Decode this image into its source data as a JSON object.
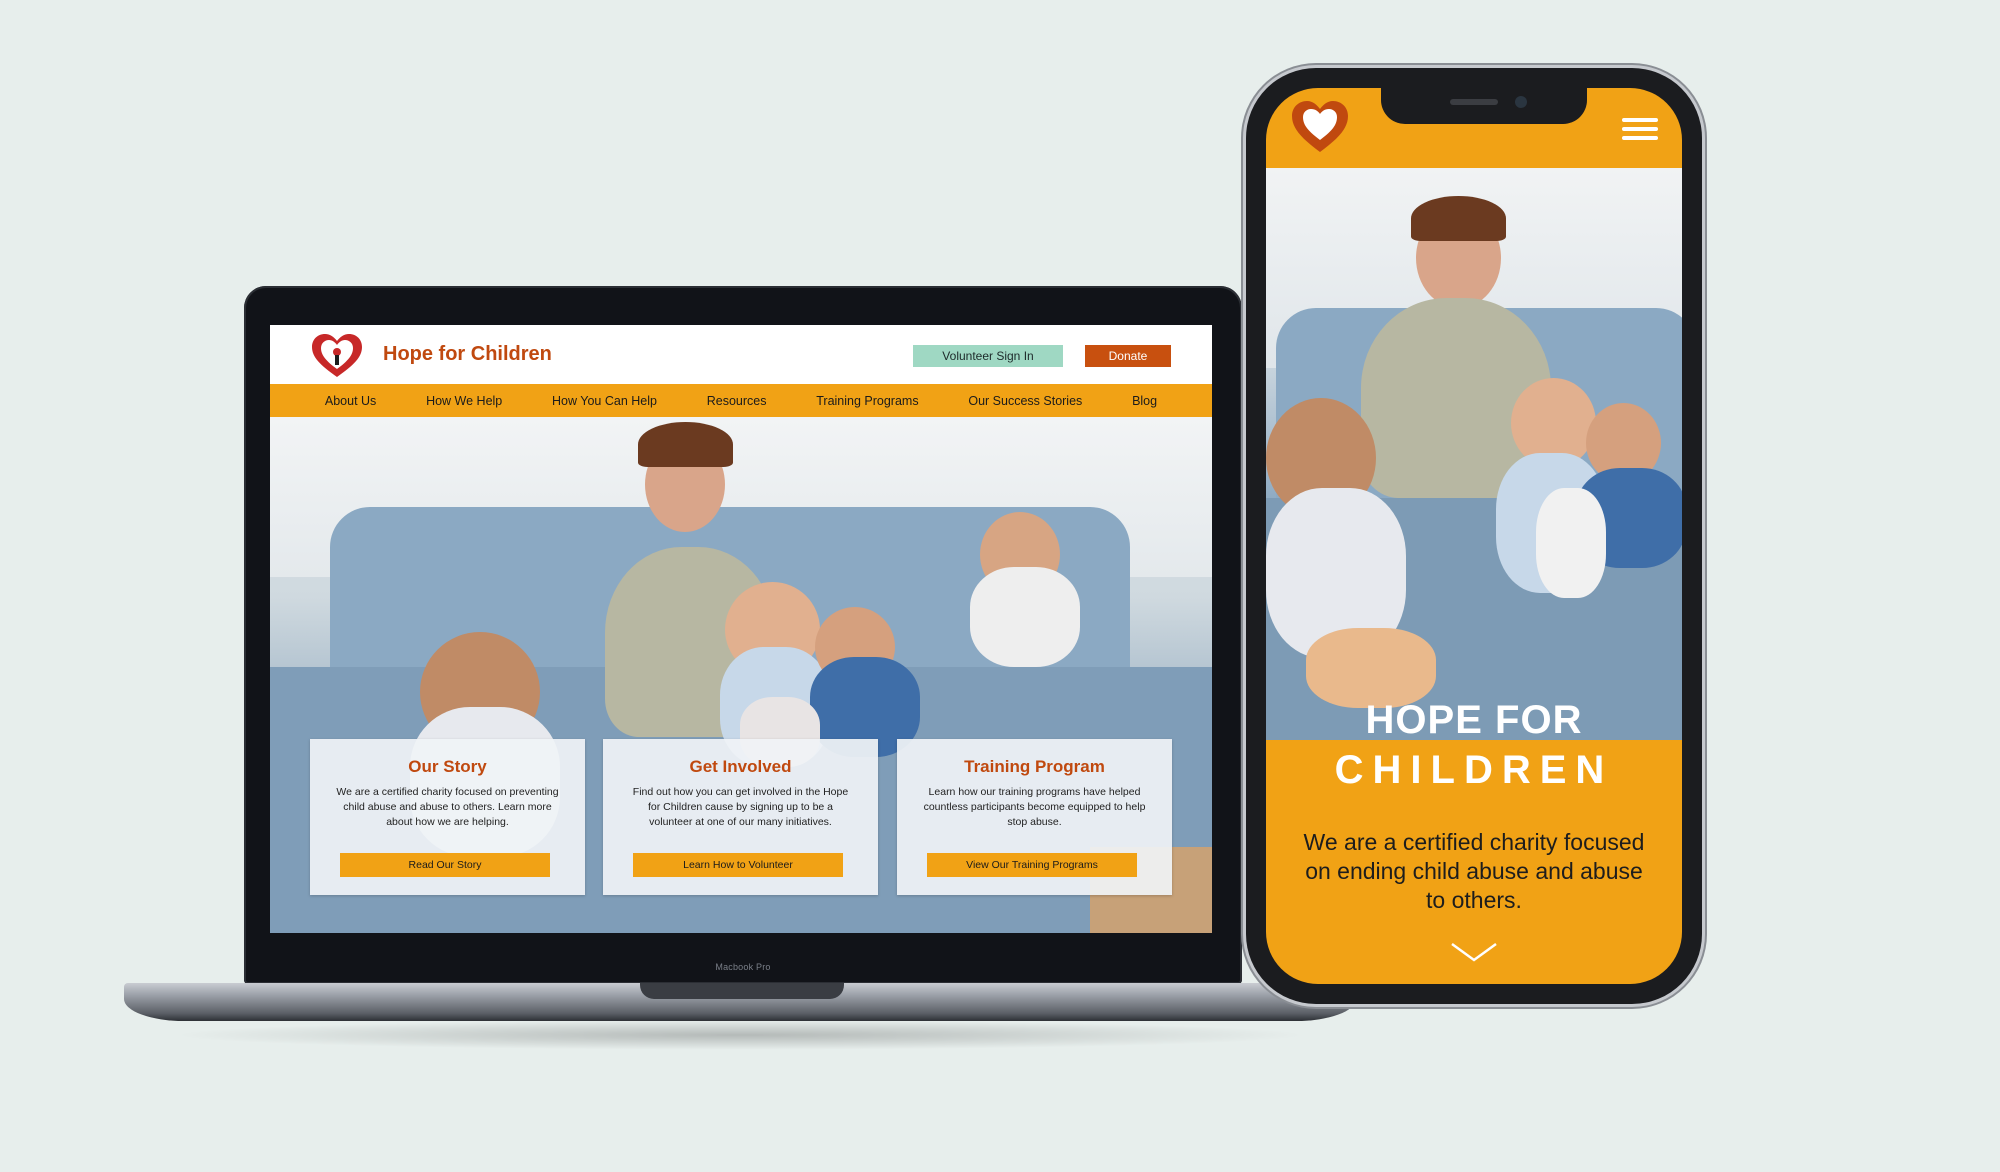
{
  "laptop": {
    "device_label": "Macbook Pro",
    "header": {
      "title": "Hope for Children",
      "volunteer_button": "Volunteer Sign In",
      "donate_button": "Donate"
    },
    "nav": [
      "About Us",
      "How We Help",
      "How You Can Help",
      "Resources",
      "Training Programs",
      "Our Success Stories",
      "Blog"
    ],
    "cards": [
      {
        "title": "Our Story",
        "text": "We are a certified charity focused on preventing child abuse and abuse to others. Learn more about how we are helping.",
        "button": "Read Our Story"
      },
      {
        "title": "Get Involved",
        "text": "Find out how you can get involved in the Hope for Children cause by signing up to be a volunteer at one of our many initiatives.",
        "button": "Learn How to Volunteer"
      },
      {
        "title": "Training Program",
        "text": "Learn how our training programs have helped countless participants become equipped to help stop abuse.",
        "button": "View Our Training Programs"
      }
    ]
  },
  "phone": {
    "title_line1": "HOPE FOR",
    "title_line2": "CHILDREN",
    "description": "We are a certified charity focused on ending child abuse and abuse to others.",
    "icons": {
      "logo": "heart-logo-icon",
      "menu": "hamburger-menu-icon",
      "scroll": "chevron-down-icon"
    }
  },
  "colors": {
    "background": "#e7eeec",
    "brand_orange": "#f1a215",
    "brand_red_orange": "#c0490f",
    "donate": "#c8500f",
    "volunteer": "#9fd8c3"
  }
}
